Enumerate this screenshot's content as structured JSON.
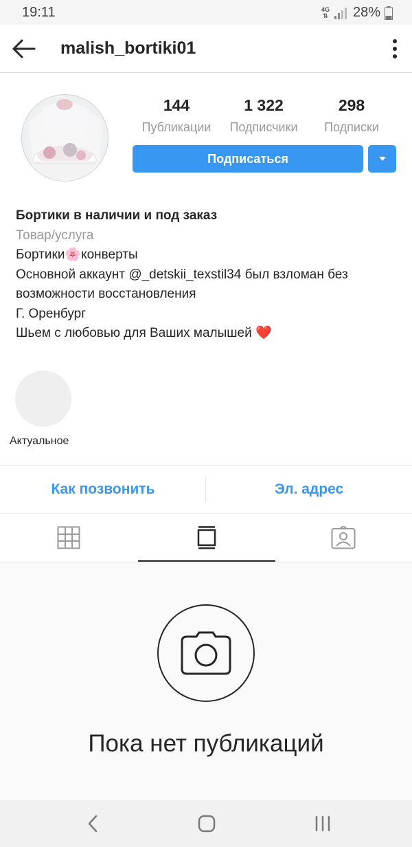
{
  "status_bar": {
    "time": "19:11",
    "network": "4G",
    "battery": "28%"
  },
  "header": {
    "username": "malish_bortiki01",
    "back_icon": "arrow-left-icon",
    "menu_icon": "more-vertical-icon"
  },
  "profile": {
    "stats": [
      {
        "value": "144",
        "label": "Публикации"
      },
      {
        "value": "1 322",
        "label": "Подписчики"
      },
      {
        "value": "298",
        "label": "Подписки"
      }
    ],
    "follow_label": "Подписаться",
    "accent_color": "#3897f0"
  },
  "bio": {
    "title": "Бортики в наличии и под заказ",
    "category": "Товар/услуга",
    "lines": [
      "Бортики🌸конверты",
      "Основной аккаунт @_detskii_texstil34 был взломан без возможности восстановления",
      "Г. Оренбург",
      "Шьем с любовью для Ваших малышей ❤️"
    ]
  },
  "highlights": [
    {
      "label": "Актуальное"
    }
  ],
  "contact": {
    "call_label": "Как позвонить",
    "email_label": "Эл. адрес"
  },
  "tabs": [
    {
      "icon": "grid-icon",
      "active": false
    },
    {
      "icon": "feed-icon",
      "active": true
    },
    {
      "icon": "tagged-icon",
      "active": false
    }
  ],
  "empty_state": {
    "icon": "camera-icon",
    "title": "Пока нет публикаций"
  },
  "nav_bar": {
    "buttons": [
      "back-icon",
      "home-icon",
      "recents-icon"
    ]
  }
}
